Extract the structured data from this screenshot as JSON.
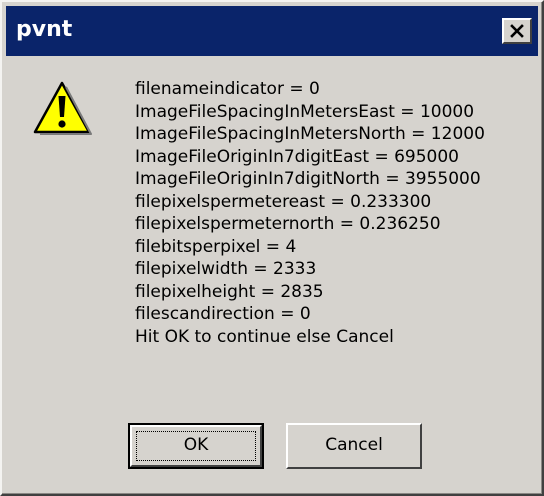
{
  "dialog": {
    "title": "pvnt",
    "close_icon": "close-icon",
    "message_icon": "warning-icon",
    "message_lines": [
      "filenameindicator = 0",
      "ImageFileSpacingInMetersEast = 10000",
      "ImageFileSpacingInMetersNorth = 12000",
      "ImageFileOriginIn7digitEast = 695000",
      "ImageFileOriginIn7digitNorth = 3955000",
      "filepixelspermetereast = 0.233300",
      "filepixelspermeternorth = 0.236250",
      "filebitsperpixel = 4",
      "filepixelwidth = 2333",
      "filepixelheight = 2835",
      "filescandirection = 0",
      "Hit OK to continue else Cancel"
    ],
    "buttons": {
      "ok_label": "OK",
      "cancel_label": "Cancel"
    }
  },
  "colors": {
    "titlebar": "#0a246a",
    "face": "#d6d3ce",
    "warning_fill": "#ffff00"
  }
}
